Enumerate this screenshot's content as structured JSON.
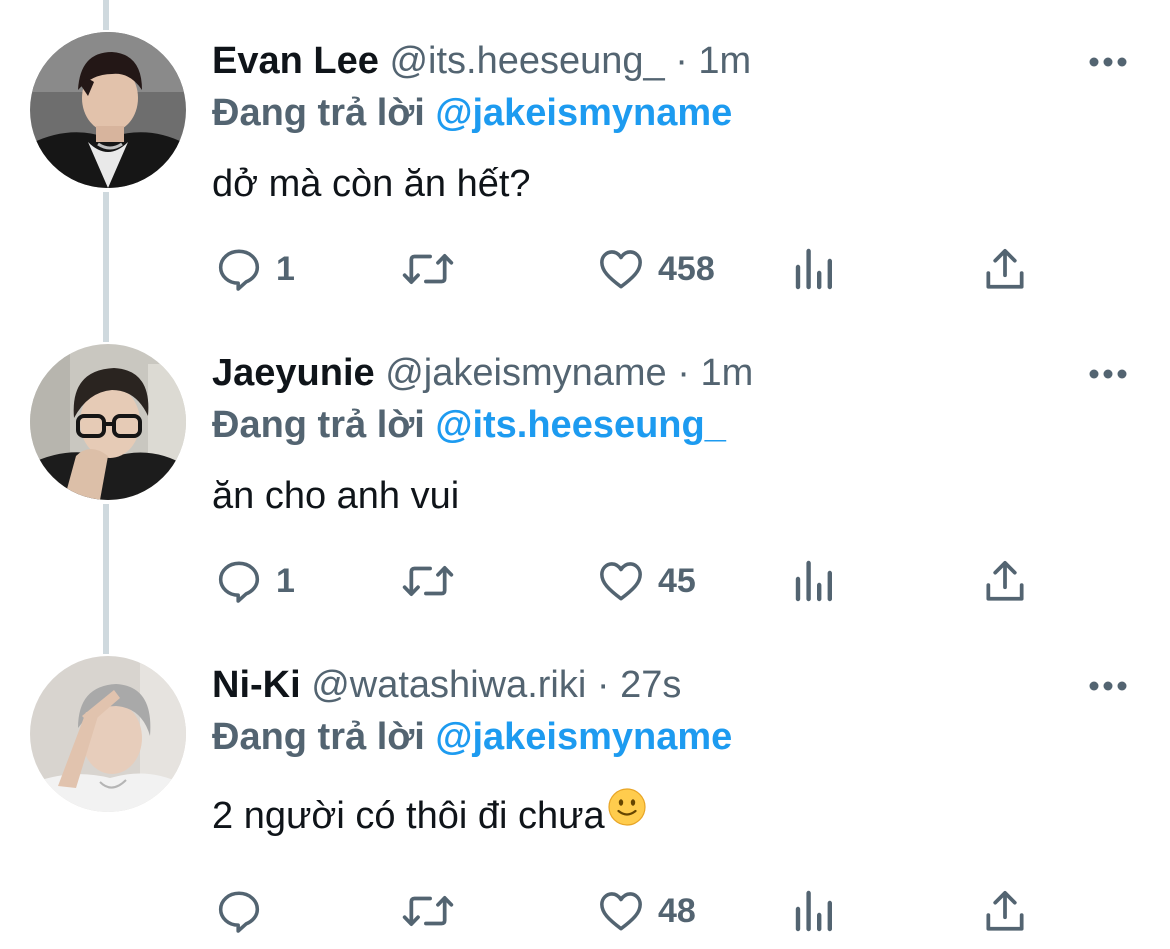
{
  "tweets": [
    {
      "display_name": "Evan Lee",
      "handle": "@its.heeseung_",
      "separator": "·",
      "time": "1m",
      "reply_prefix": "Đang trả lời",
      "reply_to": "@jakeismyname",
      "text": "dở mà còn ăn hết?",
      "reply_count": "1",
      "like_count": "458"
    },
    {
      "display_name": "Jaeyunie",
      "handle": "@jakeismyname",
      "separator": "·",
      "time": "1m",
      "reply_prefix": "Đang trả lời",
      "reply_to": "@its.heeseung_",
      "text": "ăn cho anh vui",
      "reply_count": "1",
      "like_count": "45"
    },
    {
      "display_name": "Ni-Ki",
      "handle": "@watashiwa.riki",
      "separator": "·",
      "time": "27s",
      "reply_prefix": "Đang trả lời",
      "reply_to": "@jakeismyname",
      "text": "2 người có thôi đi chưa",
      "emoji": "slightly-smiling-face-icon",
      "reply_count": "",
      "like_count": "48"
    }
  ],
  "colors": {
    "primary_text": "#0f1419",
    "secondary_text": "#536471",
    "accent": "#1d9bf0",
    "thread_line": "#cfd9de"
  },
  "icons": [
    "reply-icon",
    "retweet-icon",
    "like-icon",
    "analytics-icon",
    "share-icon",
    "more-icon"
  ]
}
